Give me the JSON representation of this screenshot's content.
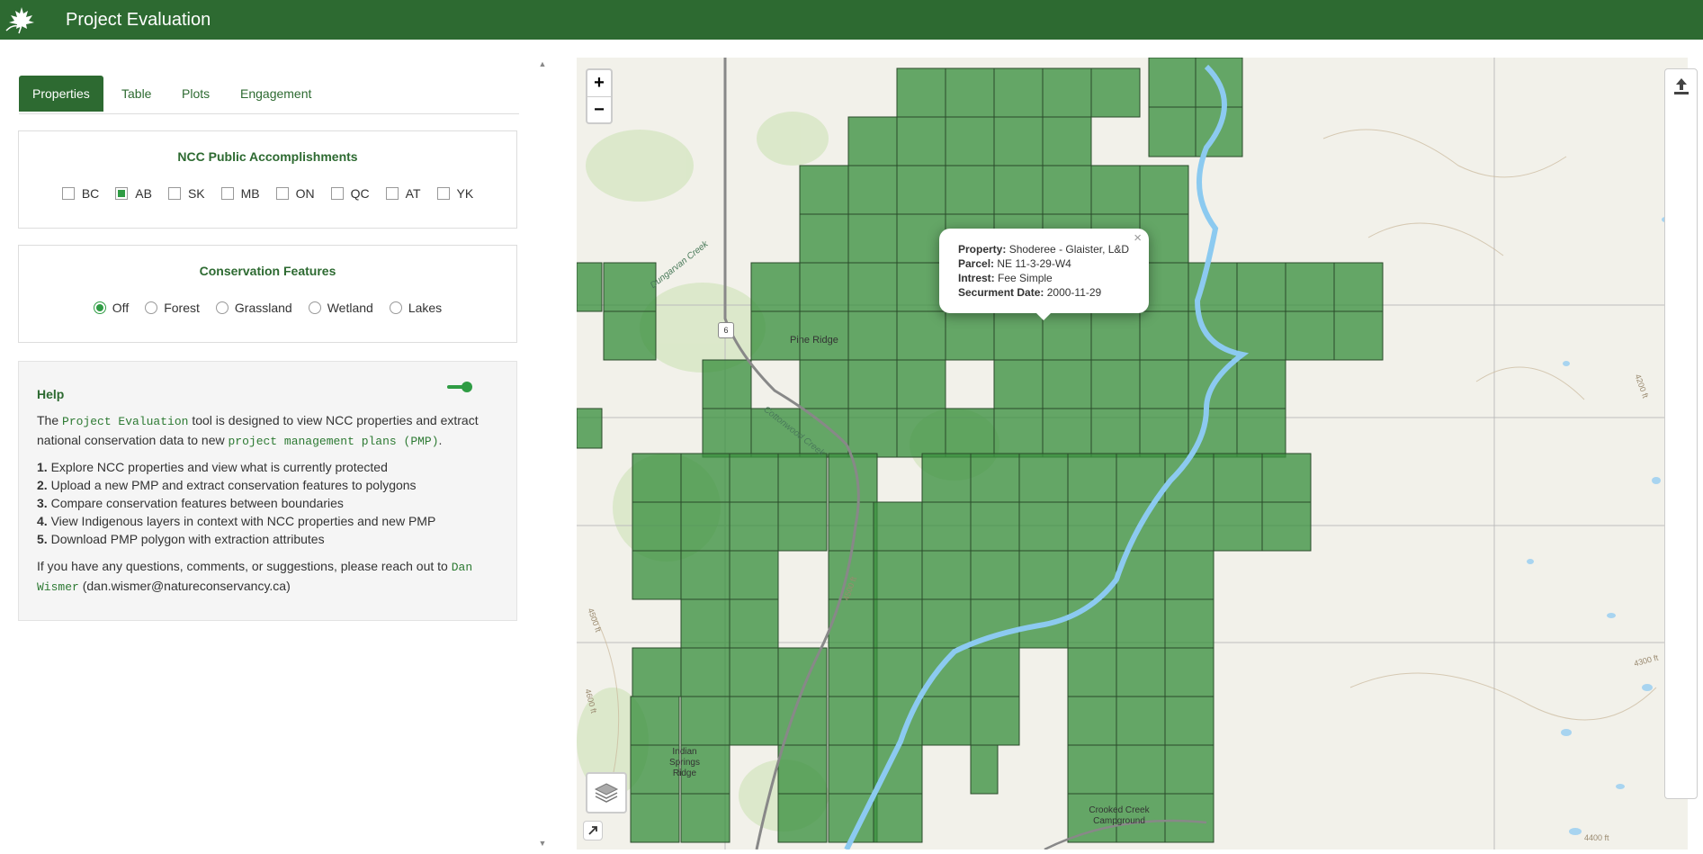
{
  "header": {
    "title": "Project Evaluation",
    "logo_icon": "maple-leaf-logo"
  },
  "tabs": [
    "Properties",
    "Table",
    "Plots",
    "Engagement"
  ],
  "active_tab": "Properties",
  "accomplishments": {
    "title": "NCC Public Accomplishments",
    "options": [
      {
        "label": "BC",
        "checked": false
      },
      {
        "label": "AB",
        "checked": true
      },
      {
        "label": "SK",
        "checked": false
      },
      {
        "label": "MB",
        "checked": false
      },
      {
        "label": "ON",
        "checked": false
      },
      {
        "label": "QC",
        "checked": false
      },
      {
        "label": "AT",
        "checked": false
      },
      {
        "label": "YK",
        "checked": false
      }
    ]
  },
  "conservation": {
    "title": "Conservation Features",
    "options": [
      {
        "label": "Off",
        "selected": true
      },
      {
        "label": "Forest",
        "selected": false
      },
      {
        "label": "Grassland",
        "selected": false
      },
      {
        "label": "Wetland",
        "selected": false
      },
      {
        "label": "Lakes",
        "selected": false
      }
    ]
  },
  "help": {
    "title": "Help",
    "intro_1": "The",
    "tool_name": "Project Evaluation",
    "intro_2": "tool is designed to view NCC properties and extract national conservation data to new",
    "pmp_text": "project management plans (PMP)",
    "intro_3": ".",
    "steps": [
      {
        "num": "1.",
        "text": "Explore NCC properties and view what is currently protected"
      },
      {
        "num": "2.",
        "text": "Upload a new PMP and extract conservation features to polygons"
      },
      {
        "num": "3.",
        "text": "Compare conservation features between boundaries"
      },
      {
        "num": "4.",
        "text": "View Indigenous layers in context with NCC properties and new PMP"
      },
      {
        "num": "5.",
        "text": "Download PMP polygon with extraction attributes"
      }
    ],
    "contact_1": "If you have any questions, comments, or suggestions, please reach out to",
    "contact_name": "Dan Wismer",
    "contact_email": "(dan.wismer@natureconservancy.ca)"
  },
  "map": {
    "zoom_in": "+",
    "zoom_out": "−",
    "labels": {
      "pine_ridge": "Pine Ridge",
      "cottonwood": "Cottonwood Creek",
      "dungarvan": "Dungarvan Creek",
      "indian_springs": "Indian Springs Ridge",
      "crooked_creek": "Crooked Creek Campground",
      "highway": "6",
      "elev_1": "4300 ft",
      "elev_2": "4400 ft",
      "elev_3": "4500 ft",
      "elev_4": "4600 ft",
      "elev_5": "4500 ft",
      "elev_6": "4200 ft"
    },
    "popup": {
      "property_label": "Property:",
      "property_value": "Shoderee - Glaister, L&D",
      "parcel_label": "Parcel:",
      "parcel_value": "NE 11-3-29-W4",
      "interest_label": "Intrest:",
      "interest_value": "Fee Simple",
      "date_label": "Securment Date:",
      "date_value": "2000-11-29",
      "close": "×"
    },
    "parcel_color": "#3c9140",
    "icons": [
      "layers-icon",
      "upload-icon",
      "expand-icon"
    ]
  }
}
